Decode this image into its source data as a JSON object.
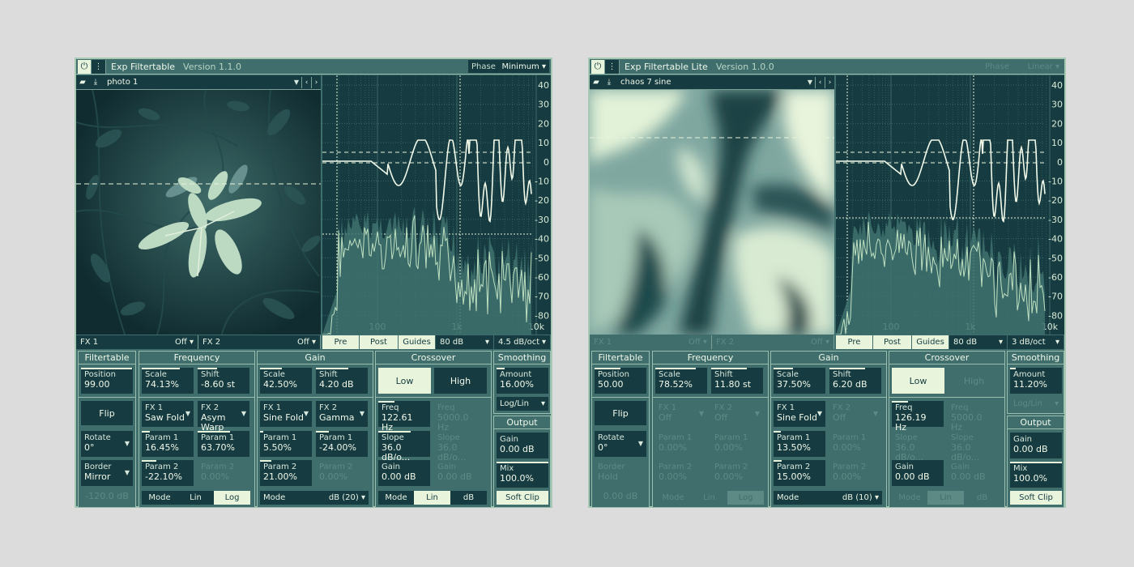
{
  "plugins": [
    {
      "title": "Exp Filtertable",
      "version": "Version 1.1.0",
      "phase": {
        "label": "Phase",
        "value": "Minimum",
        "enabled": true
      },
      "preset": "photo 1",
      "image_type": "photo",
      "fx1": {
        "label": "FX 1",
        "value": "Off"
      },
      "fx2": {
        "label": "FX 2",
        "value": "Off"
      },
      "graph": {
        "pre": "Pre",
        "post": "Post",
        "guides": "Guides",
        "range": "80 dB",
        "slope": "4.5 dB/oct"
      },
      "filtertable": {
        "title": "Filtertable",
        "position_label": "Position",
        "position_value": "99.00",
        "flip": "Flip",
        "rotate_label": "Rotate",
        "rotate_value": "0°",
        "border_label": "Border",
        "border_value": "Mirror",
        "border_gain": "-120.0 dB"
      },
      "frequency": {
        "title": "Frequency",
        "scale_label": "Scale",
        "scale_value": "74.13%",
        "shift_label": "Shift",
        "shift_value": "-8.60 st",
        "fx1_label": "FX 1",
        "fx1_value": "Saw Fold",
        "fx2_label": "FX 2",
        "fx2_value": "Asym Warp",
        "p1a_label": "Param 1",
        "p1a_value": "16.45%",
        "p1b_label": "Param 1",
        "p1b_value": "63.70%",
        "p2a_label": "Param 2",
        "p2a_value": "-22.10%",
        "p2b_label": "Param 2",
        "p2b_value": "0.00%",
        "mode": "Mode",
        "lin": "Lin",
        "log": "Log"
      },
      "gain": {
        "title": "Gain",
        "scale_label": "Scale",
        "scale_value": "42.50%",
        "shift_label": "Shift",
        "shift_value": "4.20 dB",
        "fx1_label": "FX 1",
        "fx1_value": "Sine Fold",
        "fx2_label": "FX 2",
        "fx2_value": "Gamma",
        "p1a_label": "Param 1",
        "p1a_value": "5.50%",
        "p1b_label": "Param 1",
        "p1b_value": "-24.00%",
        "p2a_label": "Param 2",
        "p2a_value": "21.00%",
        "p2b_label": "Param 2",
        "p2b_value": "0.00%",
        "mode": "Mode",
        "mode_value": "dB (20)"
      },
      "crossover": {
        "title": "Crossover",
        "low": "Low",
        "high": "High",
        "freq_label": "Freq",
        "freq_value": "122.61 Hz",
        "freq2_label": "Freq",
        "freq2_value": "5000.0 Hz",
        "slope_label": "Slope",
        "slope_value": "36.0 dB/o...",
        "slope2_label": "Slope",
        "slope2_value": "36.0 dB/o...",
        "gain_label": "Gain",
        "gain_value": "0.00 dB",
        "gain2_label": "Gain",
        "gain2_value": "0.00 dB",
        "mode": "Mode",
        "lin": "Lin",
        "db": "dB"
      },
      "smoothing": {
        "title": "Smoothing",
        "amount_label": "Amount",
        "amount_value": "16.00%",
        "loglin": "Log/Lin"
      },
      "output": {
        "title": "Output",
        "gain_label": "Gain",
        "gain_value": "0.00 dB",
        "mix_label": "Mix",
        "mix_value": "100.0%",
        "softclip": "Soft Clip"
      }
    },
    {
      "title": "Exp Filtertable Lite",
      "version": "Version 1.0.0",
      "phase": {
        "label": "Phase",
        "value": "Linear",
        "enabled": false
      },
      "preset": "chaos 7 sine",
      "image_type": "chaos",
      "fx1": {
        "label": "FX 1",
        "value": "Off"
      },
      "fx2": {
        "label": "FX 2",
        "value": "Off"
      },
      "graph": {
        "pre": "Pre",
        "post": "Post",
        "guides": "Guides",
        "range": "80 dB",
        "slope": "3 dB/oct"
      },
      "filtertable": {
        "title": "Filtertable",
        "position_label": "Position",
        "position_value": "50.00",
        "flip": "Flip",
        "rotate_label": "Rotate",
        "rotate_value": "0°",
        "border_label": "Border",
        "border_value": "Hold",
        "border_gain": "0.00 dB"
      },
      "frequency": {
        "title": "Frequency",
        "scale_label": "Scale",
        "scale_value": "78.52%",
        "shift_label": "Shift",
        "shift_value": "11.80 st",
        "fx1_label": "FX 1",
        "fx1_value": "Off",
        "fx2_label": "FX 2",
        "fx2_value": "Off",
        "p1a_label": "Param 1",
        "p1a_value": "0.00%",
        "p1b_label": "Param 1",
        "p1b_value": "0.00%",
        "p2a_label": "Param 2",
        "p2a_value": "0.00%",
        "p2b_label": "Param 2",
        "p2b_value": "0.00%",
        "mode": "Mode",
        "lin": "Lin",
        "log": "Log"
      },
      "gain": {
        "title": "Gain",
        "scale_label": "Scale",
        "scale_value": "37.50%",
        "shift_label": "Shift",
        "shift_value": "6.20 dB",
        "fx1_label": "FX 1",
        "fx1_value": "Sine Fold",
        "fx2_label": "FX 2",
        "fx2_value": "Off",
        "p1a_label": "Param 1",
        "p1a_value": "13.50%",
        "p1b_label": "Param 1",
        "p1b_value": "0.00%",
        "p2a_label": "Param 2",
        "p2a_value": "15.00%",
        "p2b_label": "Param 2",
        "p2b_value": "0.00%",
        "mode": "Mode",
        "mode_value": "dB (10)"
      },
      "crossover": {
        "title": "Crossover",
        "low": "Low",
        "high": "High",
        "freq_label": "Freq",
        "freq_value": "126.19 Hz",
        "freq2_label": "Freq",
        "freq2_value": "5000.0 Hz",
        "slope_label": "Slope",
        "slope_value": "36.0 dB/o...",
        "slope2_label": "Slope",
        "slope2_value": "36.0 dB/o...",
        "gain_label": "Gain",
        "gain_value": "0.00 dB",
        "gain2_label": "Gain",
        "gain2_value": "0.00 dB",
        "mode": "Mode",
        "lin": "Lin",
        "db": "dB"
      },
      "smoothing": {
        "title": "Smoothing",
        "amount_label": "Amount",
        "amount_value": "11.20%",
        "loglin": "Log/Lin"
      },
      "output": {
        "title": "Output",
        "gain_label": "Gain",
        "gain_value": "0.00 dB",
        "mix_label": "Mix",
        "mix_value": "100.0%",
        "softclip": "Soft Clip"
      }
    }
  ],
  "db_ticks": [
    "40",
    "30",
    "20",
    "10",
    "0",
    "-10",
    "-20",
    "-30",
    "-40",
    "-50",
    "-60",
    "-70",
    "-80"
  ],
  "freq_ticks": [
    "100",
    "1k",
    "10k"
  ],
  "icons": {
    "power": "power-icon",
    "menu": "menu-dots-icon",
    "folder": "folder-icon",
    "save": "download-icon",
    "prev": "chevron-left-icon",
    "next": "chevron-right-icon",
    "dropdown": "caret-down-icon"
  },
  "colors": {
    "background": "#dcdcdc",
    "panel": "#3f6e6c",
    "dark": "#163b40",
    "light": "#e8f4dc",
    "border": "#a7c9b4"
  }
}
